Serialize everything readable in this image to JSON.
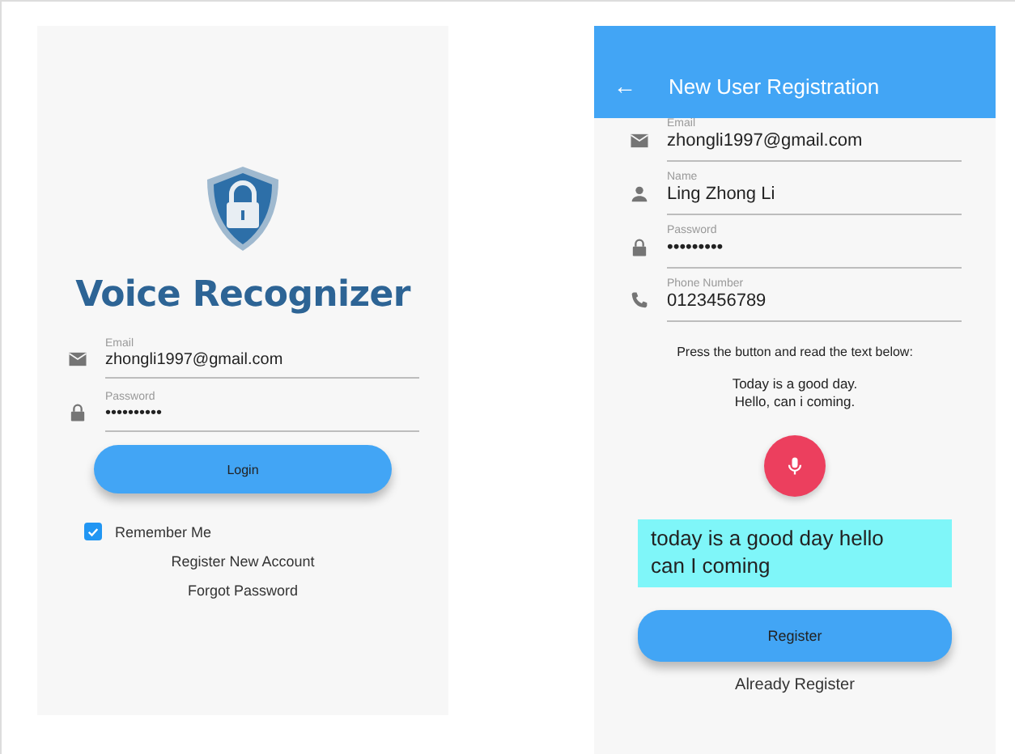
{
  "login_screen": {
    "app_title": "Voice Recognizer",
    "fields": [
      {
        "kind": "email",
        "label": "Email",
        "value": "zhongli1997@gmail.com"
      },
      {
        "kind": "password",
        "label": "Password",
        "value": "••••••••••"
      }
    ],
    "login_button": "Login",
    "remember": {
      "label": "Remember Me",
      "checked": true
    },
    "links": [
      "Register New Account",
      "Forgot Password"
    ]
  },
  "register_screen": {
    "title": "New User Registration",
    "back": "←",
    "fields": [
      {
        "kind": "email",
        "label": "Email",
        "value": "zhongli1997@gmail.com"
      },
      {
        "kind": "person",
        "label": "Name",
        "value": "Ling Zhong Li"
      },
      {
        "kind": "password",
        "label": "Password",
        "value": "•••••••••"
      },
      {
        "kind": "phone",
        "label": "Phone Number",
        "value": "0123456789"
      }
    ],
    "instruction": "Press the button and read the text below:",
    "prompt_lines": [
      "Today is a good day.",
      "Hello, can i coming."
    ],
    "recognized_text": "today is a good day hello can I coming",
    "register_button": "Register",
    "already_link": "Already Register"
  }
}
